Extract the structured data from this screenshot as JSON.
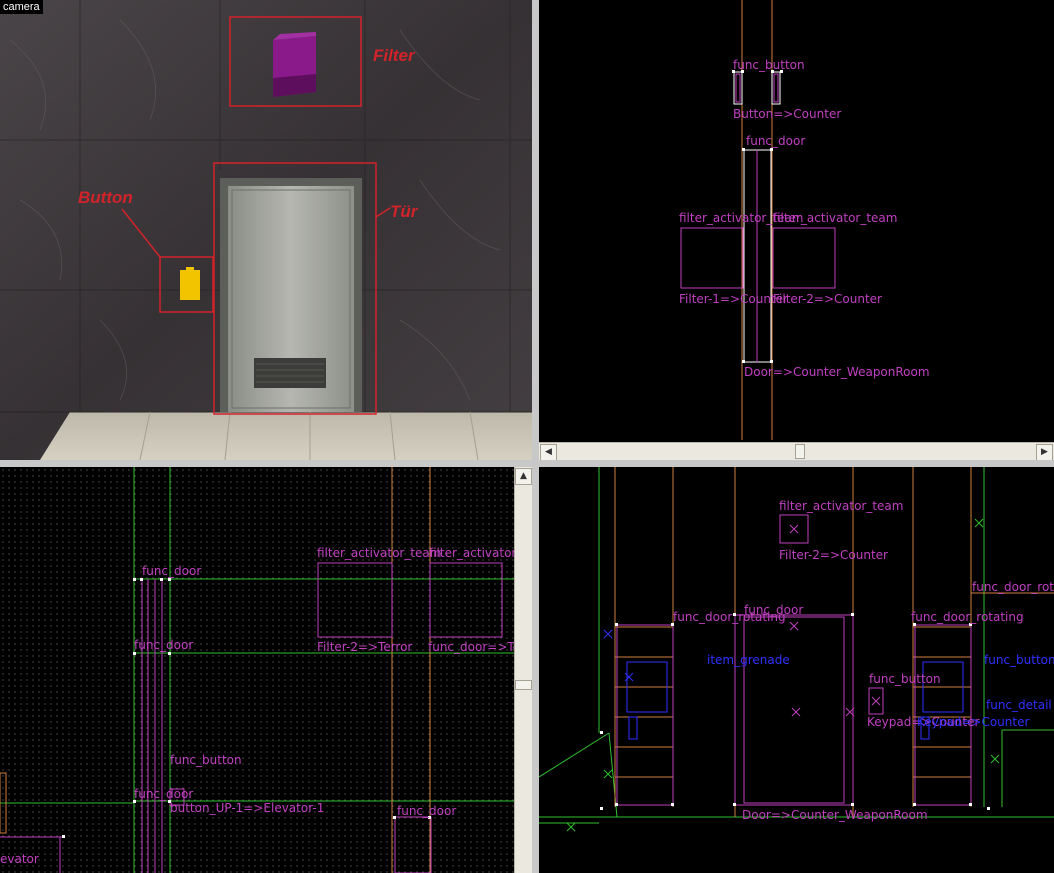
{
  "camera": {
    "title": "camera",
    "annotations": {
      "filter": "Filter",
      "button": "Button",
      "door": "Tür"
    }
  },
  "topright": {
    "labels": [
      "func_button",
      "func_door",
      "filter_activator_team",
      "filter_activator_team",
      "Filter-1=>Counter",
      "Filter-2=>Counter",
      "Door=>Counter_WeaponRoom",
      "Button=>Counter"
    ]
  },
  "bottomleft": {
    "labels": [
      "func_door",
      "func_door",
      "filter_activator_team",
      "filter_activator",
      "Filter-2=>Terror",
      "func_door=>Terror",
      "func_button",
      "func_door",
      "button_UP-1=>Elevator-1",
      "func_door",
      "evator"
    ]
  },
  "bottomright": {
    "labels": [
      "filter_activator_team",
      "Filter-2=>Counter",
      "func_door_rotating",
      "func_door",
      "func_door_rotating",
      "func_door_rota",
      "func_button",
      "Keypad=>Counter",
      "Door=>Counter_WeaponRoom",
      "func_detail",
      "item_grenade",
      "func_button",
      "Keypad=>Counter"
    ]
  },
  "colors": {
    "magenta": "#c040c0",
    "blue": "#3030ff",
    "orange": "#d08040",
    "green": "#30c030",
    "white": "#ffffff",
    "annotation_red": "#d2232a"
  }
}
